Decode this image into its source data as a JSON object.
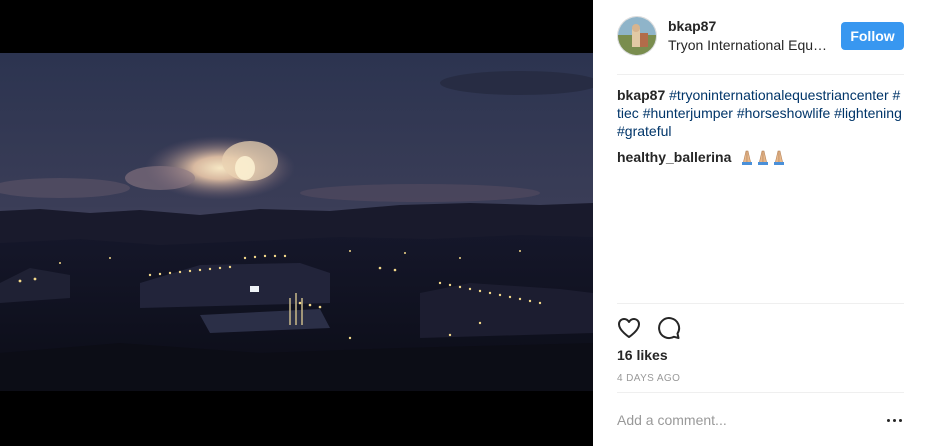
{
  "post": {
    "photo_alt": "Evening view of a lit equestrian center under a dusky sky with a glowing cloud"
  },
  "header": {
    "username": "bkap87",
    "location": "Tryon International Equestrian Center",
    "follow_label": "Follow"
  },
  "caption": {
    "username": "bkap87",
    "hashtags": [
      "#tryoninternationalequestriancenter",
      "#tiec",
      "#hunterjumper",
      "#horseshowlife",
      "#lightening",
      "#grateful"
    ]
  },
  "comments": [
    {
      "username": "healthy_ballerina",
      "text": "🙏🏼🙏🏼🙏🏼"
    }
  ],
  "actions": {
    "like_icon": "heart-icon",
    "comment_icon": "comment-bubble-icon"
  },
  "likes_text": "16 likes",
  "date_text": "4 DAYS AGO",
  "comment_box": {
    "placeholder": "Add a comment...",
    "more_icon": "more-options-icon"
  },
  "colors": {
    "accent": "#3897f0",
    "hashtag": "#003569",
    "muted": "#999999",
    "divider": "#efefef"
  }
}
